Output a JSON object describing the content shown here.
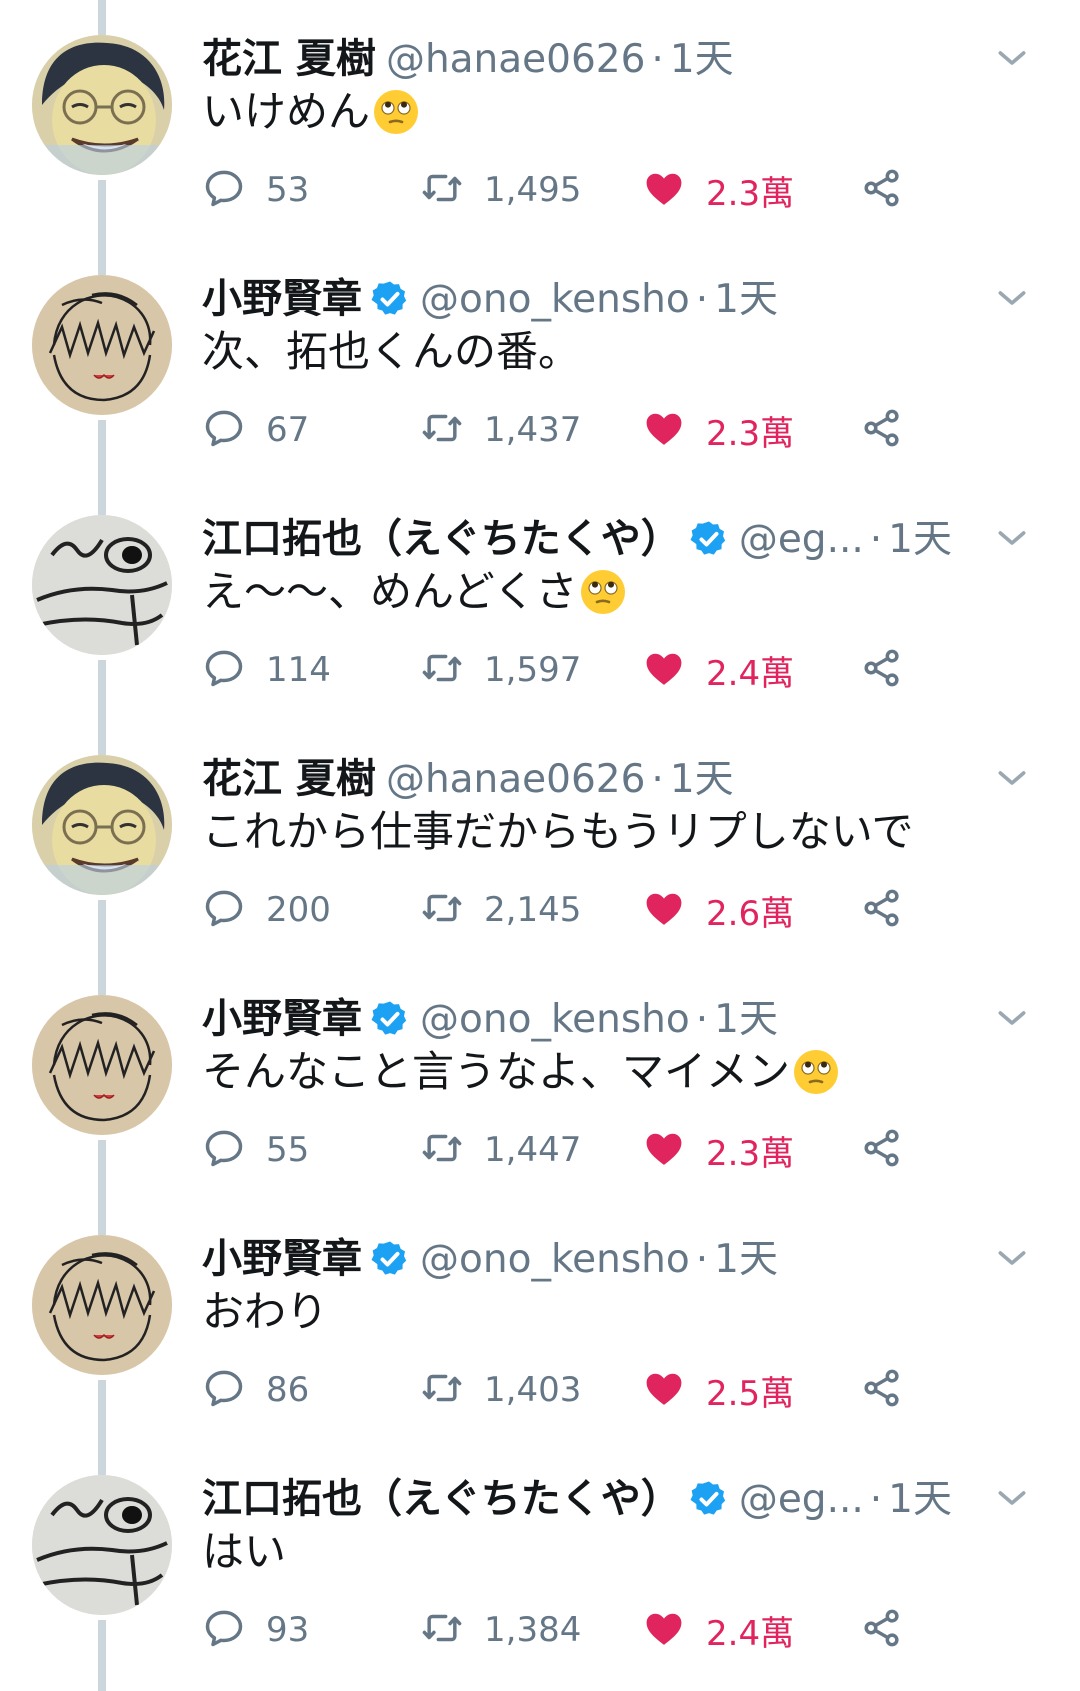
{
  "colors": {
    "text": "#14171a",
    "muted": "#657786",
    "like": "#e0245e",
    "verified": "#1da1f2",
    "thread_line": "#ccd6dd"
  },
  "icons": {
    "reply": "speech-bubble-icon",
    "retweet": "retweet-arrows-icon",
    "like": "filled-heart-icon",
    "share": "share-nodes-icon",
    "caret": "chevron-down-icon",
    "verified": "verified-badge-icon",
    "emoji": "rolling-eyes-emoji"
  },
  "tweets": [
    {
      "name": "花江 夏樹",
      "verified": false,
      "handle": "@hanae0626",
      "separator": "·",
      "time": "1天",
      "text": "いけめん",
      "has_emoji": true,
      "avatar": "hanae-avatar",
      "reply_count": "53",
      "retweet_count": "1,495",
      "like_count": "2.3萬",
      "liked": true
    },
    {
      "name": "小野賢章",
      "verified": true,
      "handle": "@ono_kensho",
      "separator": "·",
      "time": "1天",
      "text": "次、拓也くんの番。",
      "has_emoji": false,
      "avatar": "ono-avatar",
      "reply_count": "67",
      "retweet_count": "1,437",
      "like_count": "2.3萬",
      "liked": true
    },
    {
      "name": "江口拓也（えぐちたくや）",
      "verified": true,
      "handle": "@eg...",
      "separator": "·",
      "time": "1天",
      "text": "え〜〜、めんどくさ",
      "has_emoji": true,
      "avatar": "eguchi-avatar",
      "reply_count": "114",
      "retweet_count": "1,597",
      "like_count": "2.4萬",
      "liked": true
    },
    {
      "name": "花江 夏樹",
      "verified": false,
      "handle": "@hanae0626",
      "separator": "·",
      "time": "1天",
      "text": "これから仕事だからもうリプしないで",
      "has_emoji": false,
      "avatar": "hanae-avatar",
      "reply_count": "200",
      "retweet_count": "2,145",
      "like_count": "2.6萬",
      "liked": true
    },
    {
      "name": "小野賢章",
      "verified": true,
      "handle": "@ono_kensho",
      "separator": "·",
      "time": "1天",
      "text": "そんなこと言うなよ、マイメン",
      "has_emoji": true,
      "avatar": "ono-avatar",
      "reply_count": "55",
      "retweet_count": "1,447",
      "like_count": "2.3萬",
      "liked": true
    },
    {
      "name": "小野賢章",
      "verified": true,
      "handle": "@ono_kensho",
      "separator": "·",
      "time": "1天",
      "text": "おわり",
      "has_emoji": false,
      "avatar": "ono-avatar",
      "reply_count": "86",
      "retweet_count": "1,403",
      "like_count": "2.5萬",
      "liked": true
    },
    {
      "name": "江口拓也（えぐちたくや）",
      "verified": true,
      "handle": "@eg...",
      "separator": "·",
      "time": "1天",
      "text": "はい",
      "has_emoji": false,
      "avatar": "eguchi-avatar",
      "reply_count": "93",
      "retweet_count": "1,384",
      "like_count": "2.4萬",
      "liked": true
    }
  ]
}
